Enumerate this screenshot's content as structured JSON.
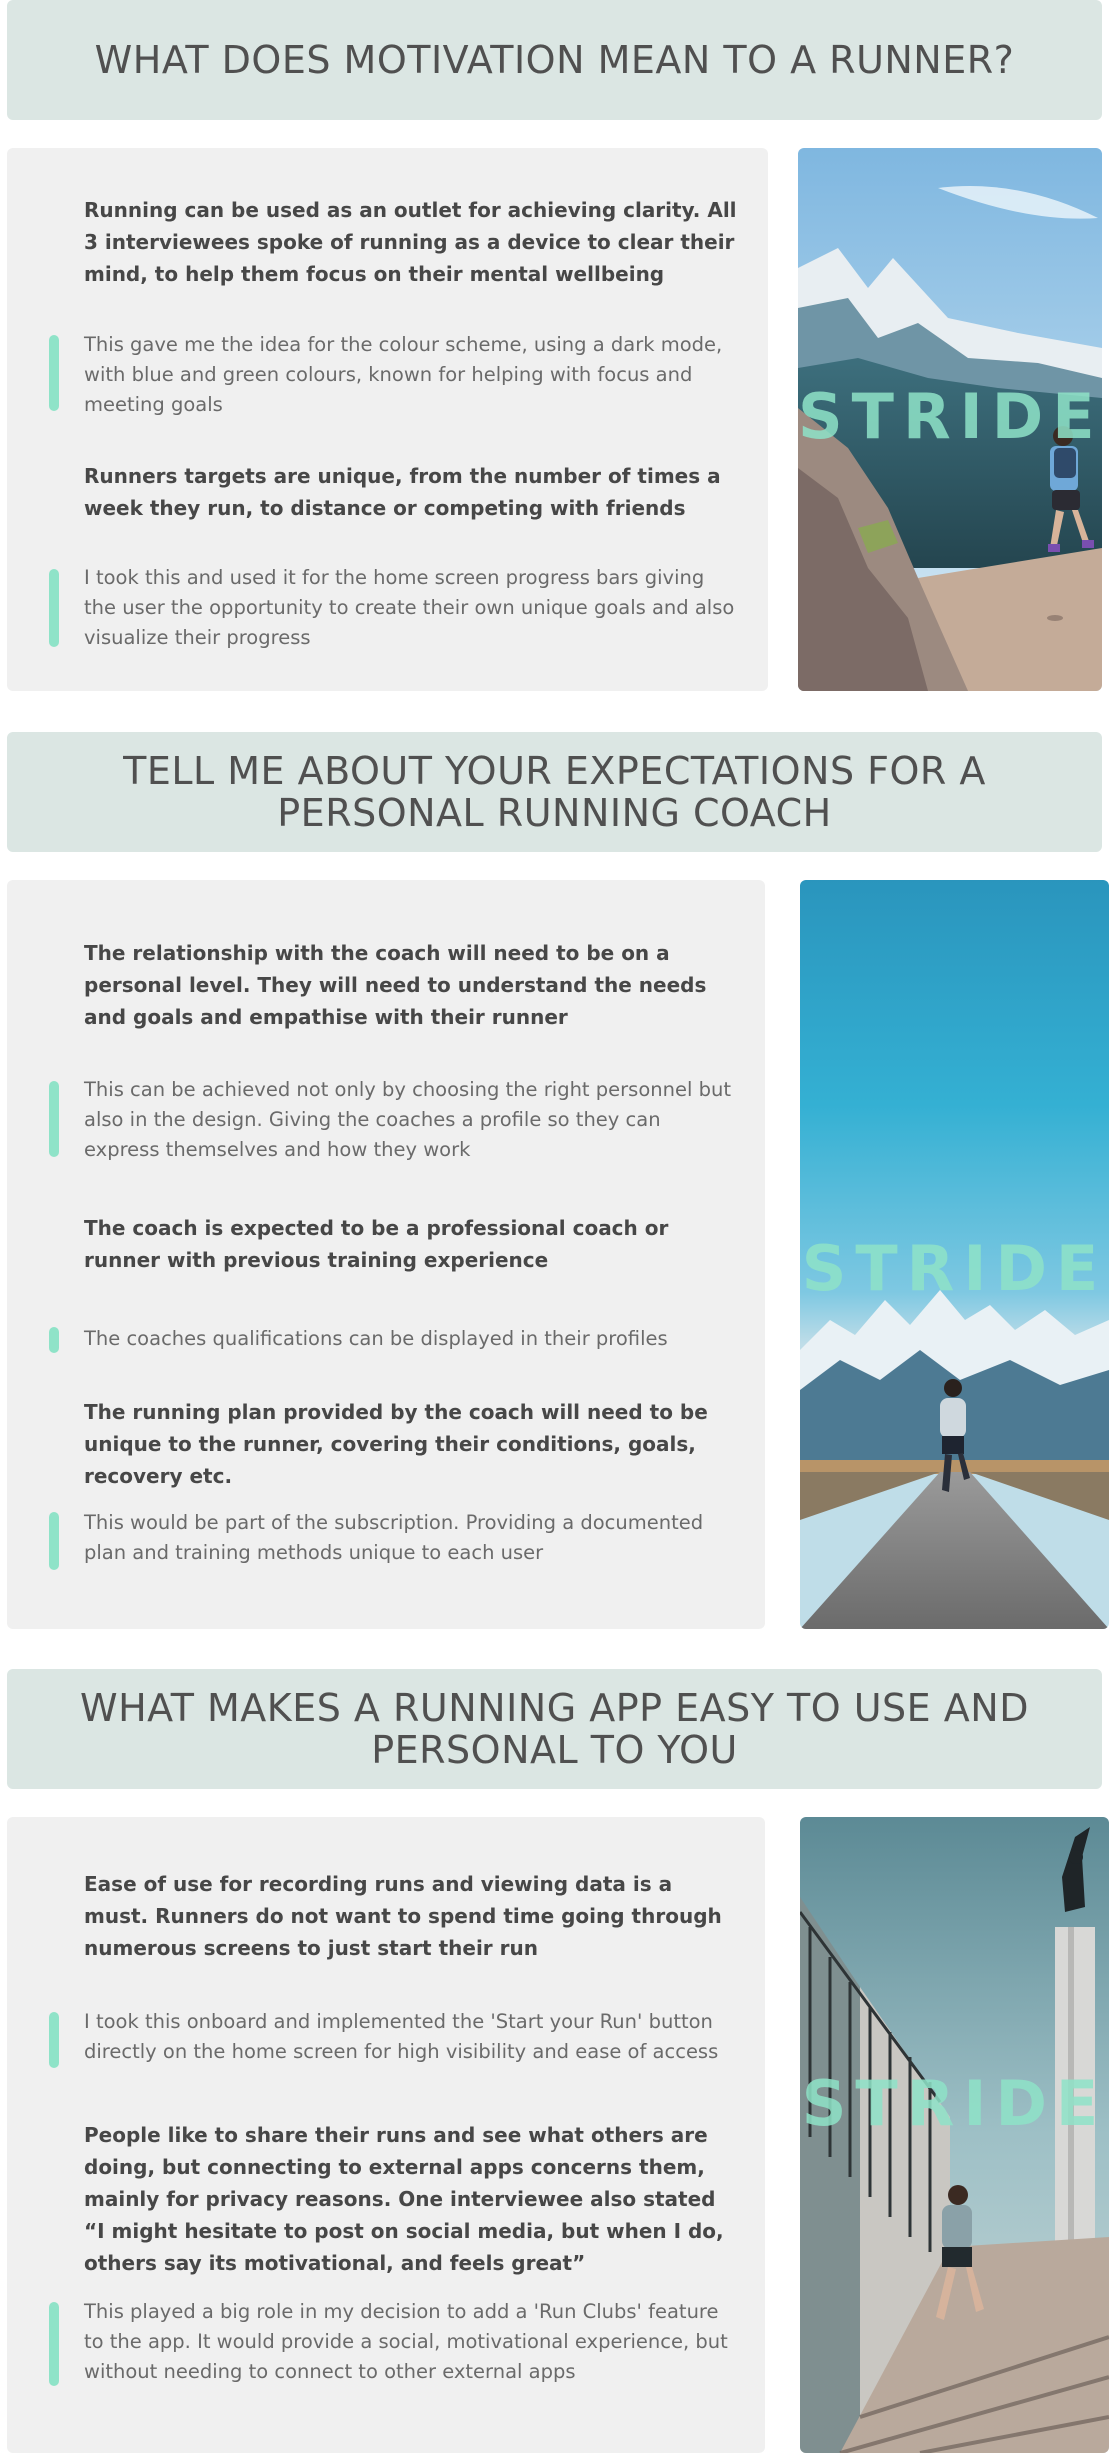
{
  "brand": "STRIDE",
  "colors": {
    "header_bg": "#dbe6e3",
    "panel_bg": "#f0f0f0",
    "accent": "#8fe3c8",
    "text": "#4a4a4a"
  },
  "sections": [
    {
      "title": "WHAT DOES MOTIVATION MEAN TO A RUNNER?",
      "items": [
        {
          "kind": "finding",
          "text": "Running can be used as an outlet for achieving clarity.  All 3 interviewees spoke of running as a device to clear their mind, to help them focus on their mental wellbeing"
        },
        {
          "kind": "insight",
          "text": "This gave me the idea for the colour scheme, using a dark mode, with blue and green colours, known for helping with focus and meeting goals"
        },
        {
          "kind": "finding",
          "text": "Runners targets are unique, from the number of times a week they run, to distance or competing with friends"
        },
        {
          "kind": "insight",
          "text": "I took this and used it for the home screen progress bars giving the user the opportunity to create their own unique goals and also visualize their progress"
        }
      ]
    },
    {
      "title": "TELL ME ABOUT YOUR EXPECTATIONS FOR A PERSONAL RUNNING COACH",
      "items": [
        {
          "kind": "finding",
          "text": "The relationship with the coach will need to be on a personal level. They will need to understand the needs and goals and empathise with their runner"
        },
        {
          "kind": "insight",
          "text": "This can be achieved not only by choosing the right personnel but also in the design. Giving the coaches a profile so they can express themselves and how they work"
        },
        {
          "kind": "finding",
          "text": "The coach is expected to be a professional coach or runner with previous training experience"
        },
        {
          "kind": "insight",
          "text": "The coaches qualifications can be displayed in their profiles"
        },
        {
          "kind": "finding",
          "text": "The running plan provided by the coach will need to be unique to the runner, covering their conditions, goals, recovery etc."
        },
        {
          "kind": "insight",
          "text": "This would be part of the subscription. Providing a  documented plan and training methods unique to each user"
        }
      ]
    },
    {
      "title": "WHAT MAKES A RUNNING APP EASY TO USE AND PERSONAL TO YOU",
      "items": [
        {
          "kind": "finding",
          "text": "Ease of use for recording runs and viewing data is a must. Runners do not want to spend time going through numerous screens to just start their run"
        },
        {
          "kind": "insight",
          "text": "I took this onboard and implemented the 'Start your Run' button directly on the home screen for high visibility and ease of access"
        },
        {
          "kind": "finding",
          "text": "People like to share their runs and see what others are doing, but connecting to external apps concerns them, mainly for privacy reasons. One interviewee also stated “I might hesitate to post on social media, but when I do, others say its motivational, and feels great”"
        },
        {
          "kind": "insight",
          "text": "This played a big role in my decision to add a 'Run Clubs' feature to the app. It would provide a social, motivational experience, but without needing to connect to other external apps"
        }
      ]
    }
  ]
}
